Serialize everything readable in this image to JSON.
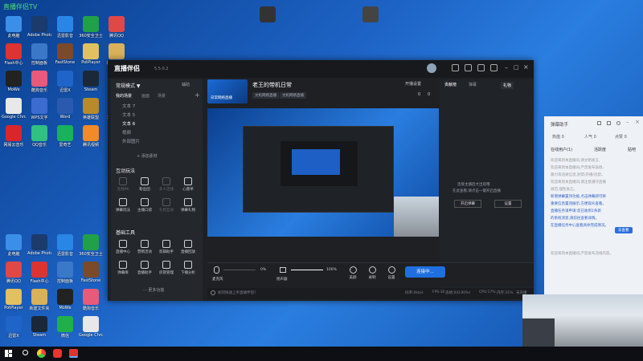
{
  "desktop": {
    "watermark": "直播伴侣TV",
    "icons": [
      {
        "label": "此电脑",
        "color": "#3c8fe8"
      },
      {
        "label": "Adobe Photoshop",
        "color": "#1a3b6c"
      },
      {
        "label": "迅雷影音",
        "color": "#2a86e6"
      },
      {
        "label": "360安全卫士",
        "color": "#21a04a"
      },
      {
        "label": "腾讯QQ",
        "color": "#e04848"
      },
      {
        "label": "Flash中心",
        "color": "#d33"
      },
      {
        "label": "控制面板",
        "color": "#3a78c8"
      },
      {
        "label": "FastStone",
        "color": "#7a4a2a"
      },
      {
        "label": "PotPlayer",
        "color": "#e0c060"
      },
      {
        "label": "新建文件夹",
        "color": "#d9b15a"
      },
      {
        "label": "MoWe",
        "color": "#222"
      },
      {
        "label": "酷狗音乐",
        "color": "#e85a7a"
      },
      {
        "label": "迅雷X",
        "color": "#1f64c9"
      },
      {
        "label": "Steam",
        "color": "#1b2838"
      },
      {
        "label": "微信",
        "color": "#20b04a"
      },
      {
        "label": "Google Chrome",
        "color": "#e8e8e8"
      },
      {
        "label": "WPS文字",
        "color": "#3c6cd0"
      },
      {
        "label": "Word",
        "color": "#2a5ab0"
      },
      {
        "label": "英雄联盟",
        "color": "#b88a2a"
      },
      {
        "label": "360浏览器",
        "color": "#1e90e0"
      },
      {
        "label": "网易云音乐",
        "color": "#d8262c"
      },
      {
        "label": "QQ音乐",
        "color": "#30c080"
      },
      {
        "label": "爱奇艺",
        "color": "#19b15a"
      },
      {
        "label": "腾讯视频",
        "color": "#f28a28"
      },
      {
        "label": "GTA5",
        "color": "#222"
      }
    ]
  },
  "app": {
    "logo_text": "直播伴侣",
    "version": "5.5.0.2",
    "mode_label": "常规模式 ▼",
    "mode_link": "辅助",
    "scene_tab_label": "我的场景",
    "scene_tab_2": "画面",
    "scene_tab_3": "场景",
    "scenes": [
      "文本 7",
      "文本 5",
      "文本 6",
      "视频",
      "外部图片"
    ],
    "add_material": "+ 添加素材",
    "interact_title": "互动玩法",
    "interact_tools": [
      "连线PK",
      "粉丝团",
      "多人连线",
      "心愿单",
      "弹幕玩法",
      "主播口袋",
      "礼物互动",
      "弹幕礼物"
    ],
    "basic_title": "基础工具",
    "basic_tools": [
      "直播中心",
      "营销活动",
      "剪辑助手",
      "直播回放",
      "弹幕库",
      "直播助手",
      "房管管理",
      "下播分析"
    ],
    "more_tools": "··· 更多功能",
    "stream_title": "老王的带机日常",
    "stream_tag_1": "文机网络直播",
    "stream_tag_2": "文机网络直播",
    "thumb_label": "日常网络直播",
    "settings_button": "开播设置",
    "stream_stats": [
      {
        "value": "0"
      },
      {
        "value": "0"
      }
    ],
    "audio": {
      "mic_label": "麦克风",
      "mic_value": "0%",
      "speaker_label": "扬声器",
      "speaker_value": "100%"
    },
    "bottom_tools": [
      "美颜",
      "录制",
      "设置"
    ],
    "go_live_button": "连接中...",
    "hint_text": "如何快速上手直播伴侣?",
    "status_items": [
      "码率:0kb/s",
      "FPS:30",
      "丢帧:0(0.00%)",
      "CPU:17%",
      "内存:31%",
      "未开播"
    ],
    "side": {
      "tab_1": "贡献榜",
      "tab_2": "弹幕",
      "tab_3": "礼物",
      "notice_1": "连接主播后才出现哦",
      "notice_2": "在此查看,请点击一键开启直播",
      "btn_left": "开启弹幕",
      "btn_right": "设置"
    }
  },
  "right_panel": {
    "title": "弹幕助手",
    "stats": [
      {
        "label": "热值",
        "value": "0"
      },
      {
        "label": "人气",
        "value": "0"
      },
      {
        "label": "点赞",
        "value": "0"
      }
    ],
    "tabs": [
      "在线用户(1)",
      "活跃度",
      "贴吧"
    ],
    "lines": [
      "欢迎来到本直播间,请文明发言,",
      "欢迎来到本直播间,严禁发布低俗、",
      "暴力等违规信息,封禁/开播/违禁。",
      "欢迎来到本直播间,请注意遵守直播",
      "规范,理性发言。",
      "新增弹幕置顶功能,点击弹幕即可将",
      "重要信息置顶展示,方便观众查看。",
      "直播任务请申请:您已收到1条新",
      "的系统消息,请前往查看详情。",
      "在直播任务中心查看具体完成情况。"
    ],
    "badge": "去查看",
    "footer": "欢迎来到本直播间,严禁发布违规内容。"
  },
  "taskbar": {
    "search_icon": "search-icon"
  }
}
